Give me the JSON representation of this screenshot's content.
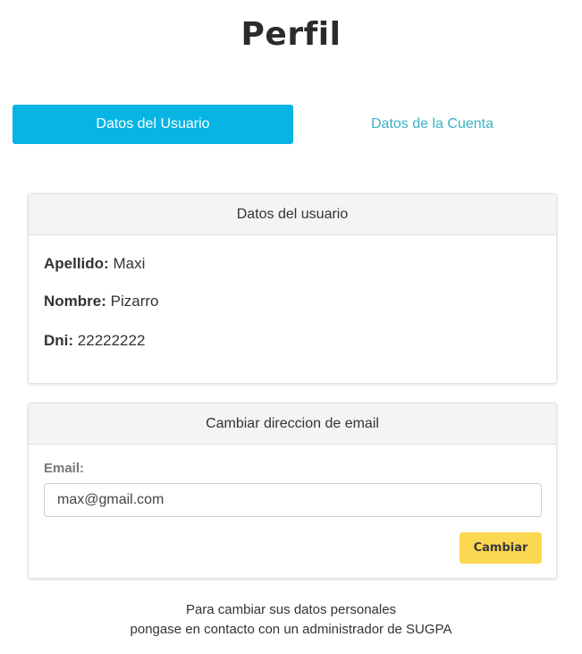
{
  "page": {
    "title": "Perfil"
  },
  "tabs": [
    {
      "label": "Datos del Usuario",
      "active": true
    },
    {
      "label": "Datos de la Cuenta",
      "active": false
    }
  ],
  "user_card": {
    "header": "Datos del usuario",
    "fields": [
      {
        "label": "Apellido:",
        "value": "Maxi"
      },
      {
        "label": "Nombre:",
        "value": "Pizarro"
      },
      {
        "label": "Dni:",
        "value": "22222222"
      }
    ]
  },
  "email_card": {
    "header": "Cambiar direccion de email",
    "label": "Email:",
    "value": "max@gmail.com",
    "button_label": "Cambiar"
  },
  "footer": {
    "line1": "Para cambiar sus datos personales",
    "line2": "pongase en contacto con un administrador de SUGPA"
  },
  "colors": {
    "tab_active_bg": "#07b4e4",
    "tab_inactive_text": "#3bb1c6",
    "button_bg": "#fbd851"
  }
}
